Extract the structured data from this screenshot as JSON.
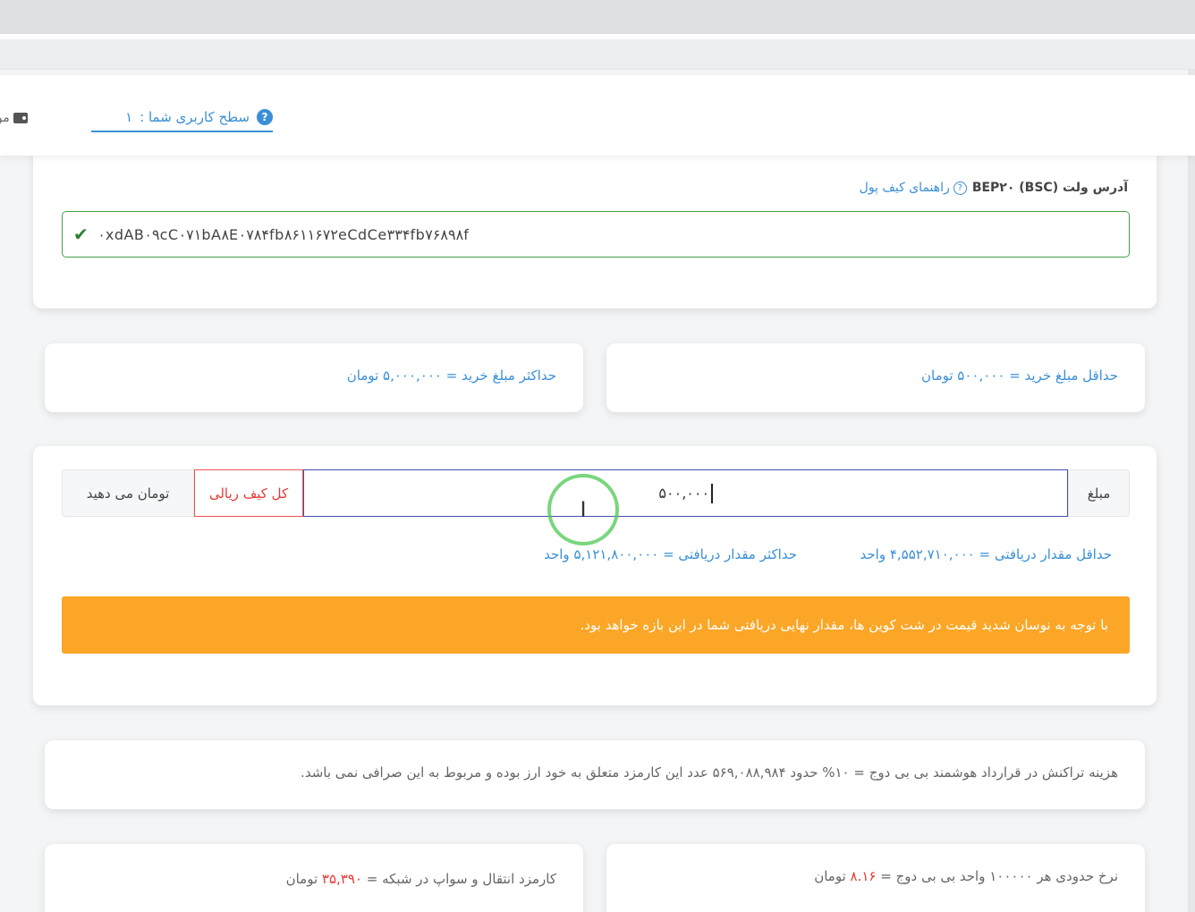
{
  "header": {
    "level_label": "سطح کاربری شما :",
    "level_value": "۱",
    "wallet_label": "مو"
  },
  "wallet": {
    "label": "آدرس ولت BEP۲۰ (BSC)",
    "guide_link": "راهنمای کیف پول",
    "address": "۰xdAB۰۹cC۰۷۱bA۸E۰۷۸۴fb۸۶۱۱۶۷۲eCdCe۳۳۴fb۷۶۸۹۸f"
  },
  "limits": {
    "min_purchase": "حداقل مبلغ خرید = ۵۰۰,۰۰۰ تومان",
    "max_purchase": "حداکثر مبلغ خرید = ۵,۰۰۰,۰۰۰ تومان"
  },
  "amount": {
    "prefix": "مبلغ",
    "value": "۵۰۰,۰۰۰",
    "wallet_all": "کل کیف ریالی",
    "suffix": "تومان می دهید",
    "min_receive": "حداقل مقدار دریافتی = ۴,۵۵۲,۷۱۰,۰۰۰ واحد",
    "max_receive": "حداکثر مقدار دریافتی = ۵,۱۲۱,۸۰۰,۰۰۰ واحد",
    "warning": "با توجه به نوسان شدید قیمت در شت کوین ها، مقدار نهایی دریافتی شما در این بازه خواهد بود."
  },
  "fee": {
    "text": "هزینه تراکنش در قرارداد هوشمند بی بی دوج = ۱۰% حدود ۵۶۹,۰۸۸,۹۸۴ عدد این کارمزد متعلق به خود ارز بوده و مربوط به این صرافی نمی باشد."
  },
  "rate": {
    "prefix": "نرخ حدودی هر ۱۰۰۰۰۰ واحد بی بی دوج =",
    "value": "۸.۱۶",
    "unit": "تومان"
  },
  "transfer": {
    "prefix": "کارمزد انتقال و سواپ در شبکه =",
    "value": "۳۵,۳۹۰",
    "unit": "تومان"
  },
  "colors": {
    "accent_blue": "#3a8fd6",
    "warning_orange": "#fba626",
    "success_green": "#43a047",
    "danger_red": "#e53935"
  }
}
